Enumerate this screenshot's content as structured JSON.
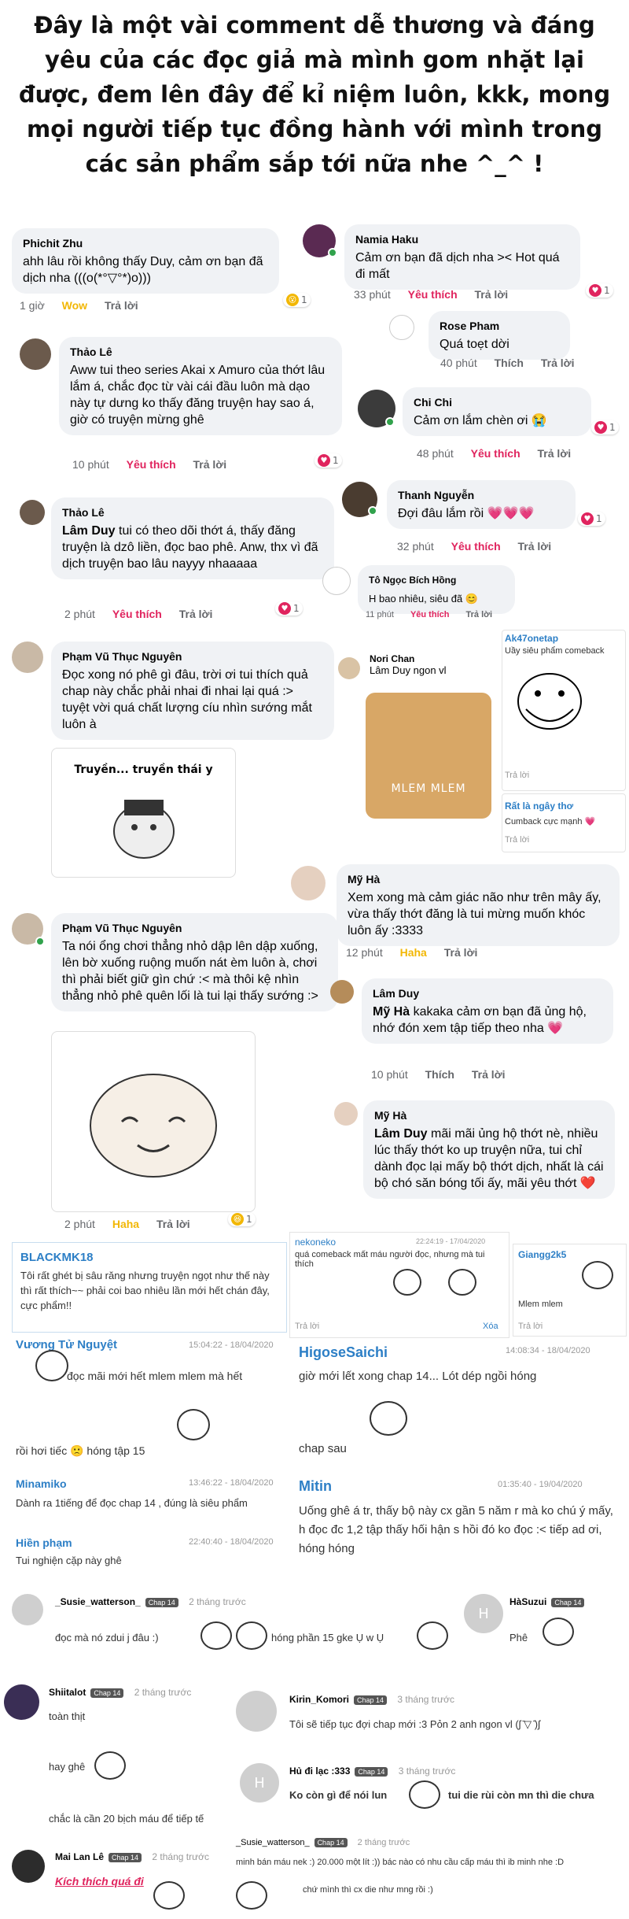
{
  "header": {
    "line1": "Đây là một vài comment dễ thương và đáng",
    "line2": "yêu của các đọc giả mà mình gom nhặt lại",
    "line3": "được, đem lên đây để kỉ niệm luôn, kkk, mong",
    "line4": "mọi người tiếp tục đồng hành với mình trong",
    "line5": "các sản phẩm sắp tới nữa nhe ^_^ !"
  },
  "comments": {
    "phichit": {
      "name": "Phichit Zhu",
      "text": "ahh lâu rồi không thấy Duy, cảm ơn bạn đã dịch nha (((o(*°▽°*)o)))",
      "time": "1 giờ",
      "react": "Wow",
      "reply": "Trả lời",
      "count": "1"
    },
    "namia": {
      "name": "Namia Haku",
      "text": "Cảm ơn bạn đã dịch nha >< Hot quá đi mất",
      "time": "33 phút",
      "react": "Yêu thích",
      "reply": "Trả lời",
      "count": "1"
    },
    "rose": {
      "name": "Rose Pham",
      "text": "Quá toẹt dời",
      "time": "40 phút",
      "react": "Thích",
      "reply": "Trả lời"
    },
    "thao1": {
      "name": "Thảo Lê",
      "text": "Aww tui theo series Akai x Amuro của thớt lâu lắm á, chắc đọc từ vài cái đầu luôn mà dạo này tự dưng ko thấy đăng truyện hay sao á, giờ có truyện mừng ghê",
      "time": "10 phút",
      "react": "Yêu thích",
      "reply": "Trả lời",
      "count": "1"
    },
    "chichi": {
      "name": "Chi Chi",
      "text": "Cảm ơn lắm chèn ơi 😭",
      "time": "48 phút",
      "react": "Yêu thích",
      "reply": "Trả lời",
      "count": "1"
    },
    "thao2": {
      "name": "Thảo Lê",
      "tag": "Lâm Duy",
      "text": " tui có theo dõi thớt á, thấy đăng truyện là dzô liền, đọc bao phê. Anw, thx vì đã dịch truyện bao lâu nayyy nhaaaaa",
      "time": "2 phút",
      "react": "Yêu thích",
      "reply": "Trả lời",
      "count": "1"
    },
    "thanh": {
      "name": "Thanh Nguyễn",
      "text": "Đợi đâu lắm rồi 💗💗💗",
      "time": "32 phút",
      "react": "Yêu thích",
      "reply": "Trả lời",
      "count": "1"
    },
    "tongoc": {
      "name": "Tô Ngọc Bích Hồng",
      "text": "H bao nhiêu, siêu đã 😊",
      "time": "11 phút",
      "react": "Yêu thích",
      "reply": "Trả lời"
    },
    "pham1": {
      "name": "Phạm Vũ Thục Nguyên",
      "text": "Đọc xong nó phê gì đâu, trời ơi tui thích quả chap này chắc phải nhai đi nhai lại quá :> tuyệt vời quá chất lượng cíu nhìn sướng mắt luôn à",
      "sticker": "Truyền... truyền thái y"
    },
    "nori": {
      "name": "Nori Chan",
      "tag": "Lâm Duy",
      "text": " ngon vl",
      "img": "MLEM MLEM"
    },
    "ak47": {
      "name": "Ak47onetap",
      "text": "Uầy siêu phẩm comeback",
      "reply": "Trả lời"
    },
    "rat": {
      "name": "Rất là ngây thơ",
      "text": "Cumback cực mạnh 💗",
      "reply": "Trả lời"
    },
    "pham2": {
      "name": "Phạm Vũ Thục Nguyên",
      "text": "Ta nói ổng chơi thẳng nhỏ dập lên dập xuống, lên bờ xuống ruộng muốn nát èm luôn à, chơi thì phải biết giữ gìn chứ :< mà thôi kệ nhìn thẳng nhỏ phê quên lối là tui lại thấy sướng :>",
      "time": "2 phút",
      "react": "Haha",
      "reply": "Trả lời",
      "count": "1"
    },
    "myha1": {
      "name": "Mỹ Hà",
      "text": "Xem xong mà cảm giác não như trên mây ấy, vừa thấy thớt đăng là tui mừng muốn khóc luôn ấy :3333",
      "time": "12 phút",
      "react": "Haha",
      "reply": "Trả lời"
    },
    "lamduy": {
      "name": "Lâm Duy",
      "tag": "Mỹ Hà",
      "text": " kakaka cảm ơn bạn đã ủng hộ, nhớ đón xem tập tiếp theo nha 💗",
      "time": "10 phút",
      "react": "Thích",
      "reply": "Trả lời"
    },
    "myha2": {
      "name": "Mỹ Hà",
      "tag": "Lâm Duy",
      "text": " mãi mãi ủng hộ thớt nè, nhiều lúc thấy thớt ko up truyện nữa, tui chỉ dành đọc lại mấy bộ thớt dịch, nhất là cái bộ chó săn bóng tối ấy, mãi yêu thớt ❤️"
    }
  },
  "panels": {
    "blackmk": {
      "name": "BLACKMK18",
      "text": "Tôi rất ghét bị sâu răng nhưng truyện ngọt như thế này thì rất thích~~ phải coi bao nhiêu lần mới hết chán đây, cực phẩm!!"
    },
    "nekoneko": {
      "name": "nekoneko",
      "time": "22:24:19 - 17/04/2020",
      "text": "quá comeback mất máu người đọc, nhưng mà tui thích",
      "reply": "Trả lời",
      "delete": "Xóa"
    },
    "giangg": {
      "name": "Giangg2k5",
      "text": "Mlem mlem",
      "reply": "Trả lời"
    },
    "vuong": {
      "name": "Vương Tử Nguyệt",
      "time": "15:04:22 - 18/04/2020",
      "text1": "đọc mãi mới hết mlem mlem mà hết",
      "text2": "rồi hơi tiếc 🙁 hóng tập 15"
    },
    "higose": {
      "name": "HigoseSaichi",
      "time": "14:08:34 - 18/04/2020",
      "text1": "giờ mới lết xong chap 14... Lót dép ngồi hóng",
      "text2": "chap sau"
    },
    "minamiko": {
      "name": "Minamiko",
      "time": "13:46:22 - 18/04/2020",
      "text": "Dành ra 1tiếng để đọc chap 14 , đúng là siêu phẩm"
    },
    "hien": {
      "name": "Hiền phạm",
      "time": "22:40:40 - 18/04/2020",
      "text": "Tui nghiện cặp này ghê"
    },
    "mitin": {
      "name": "Mitin",
      "time": "01:35:40 - 19/04/2020",
      "text": "Uống ghê á tr, thấy bộ này cx gần 5 năm r mà ko chú ý mấy, h đọc đc 1,2 tập thấy hối hận s hồi đó ko đọc :< tiếp ad ơi, hóng hóng"
    }
  },
  "bottom": {
    "susie1": {
      "name": "_Susie_watterson_",
      "chap": "Chap 14",
      "ago": "2 tháng trước",
      "text1": "đọc mà nó zdui j đâu :)",
      "text2": "hóng phần 15 gke Ụ w Ụ"
    },
    "hasuzui": {
      "name": "HàSuzui",
      "chap": "Chap 14",
      "text": "Phê",
      "avatar": "H"
    },
    "shiitalot": {
      "name": "Shiitalot",
      "chap": "Chap 14",
      "ago": "2 tháng trước",
      "text1": "toàn thịt",
      "text2": "hay ghê",
      "text3": "chắc là cần 20 bịch máu để tiếp tế"
    },
    "kirin": {
      "name": "Kirin_Komori",
      "chap": "Chap 14",
      "ago": "3 tháng trước",
      "text": "Tôi sẽ tiếp tục đợi chap mới :3 Pỏn 2 anh ngon vl (ʃ ̄▽ ̄)ʃ"
    },
    "hudilac": {
      "name": "Hủ đi lạc :333",
      "chap": "Chap 14",
      "ago": "3 tháng trước",
      "text1": "Ko còn gì để nói lun",
      "text2": "tui die rùi còn mn thì die chưa",
      "avatar": "H"
    },
    "susie2": {
      "name": "_Susie_watterson_",
      "chap": "Chap 14",
      "ago": "2 tháng trước",
      "text1": "minh bán máu nek :) 20.000 một lít :)) bác nào có nhu cầu cấp máu thì ib minh nhe :D",
      "text2": "chứ mình thì cx die như mng rồi :)"
    },
    "mailan": {
      "name": "Mai Lan Lê",
      "chap": "Chap 14",
      "ago": "2 tháng trước",
      "text": "Kích thích quá đi"
    }
  }
}
